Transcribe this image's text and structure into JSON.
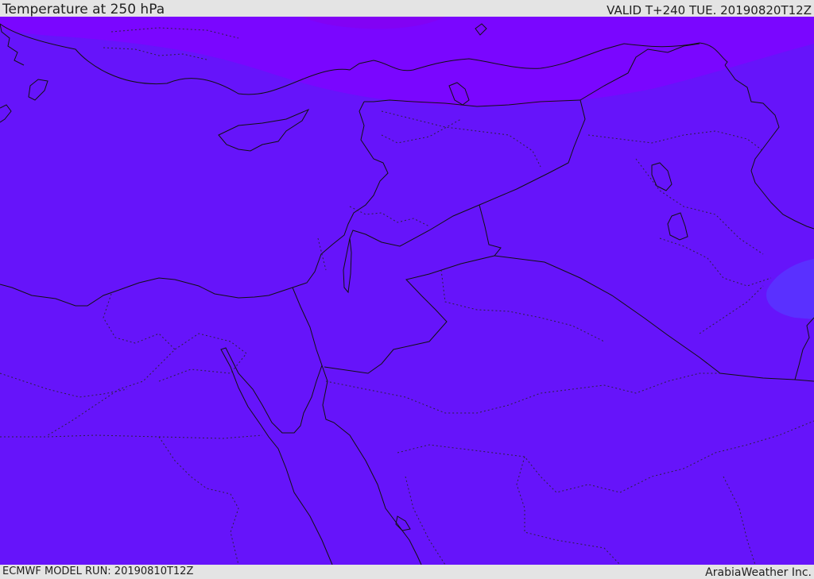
{
  "header": {
    "title": "Temperature at 250 hPa",
    "valid": "VALID T+240 TUE. 20190820T12Z"
  },
  "footer": {
    "model_run": "ECMWF MODEL RUN: 20190810T12Z",
    "credit": "ArabiaWeather Inc."
  },
  "colors": {
    "field_base": "#6614fa",
    "field_cold_band": "#7a06ff",
    "field_coldest": "#8202f4",
    "field_warm_patch": "#5a30ff",
    "header_bg": "#e4e4e4",
    "line": "#111111"
  }
}
